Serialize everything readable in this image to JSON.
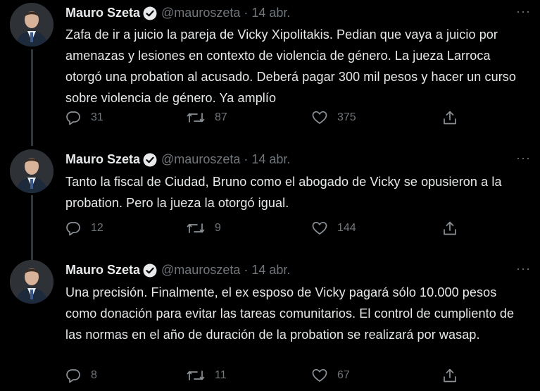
{
  "tweets": [
    {
      "author": "Mauro Szeta",
      "handle": "@mauroszeta",
      "separator": "·",
      "date": "14 abr.",
      "text": "Zafa de ir a juicio la pareja de Vicky Xipolitakis. Pedian que vaya a juicio por amenazas y lesiones en contexto de violencia de género. La jueza Larroca otorgó una probation al acusado. Deberá pagar 300 mil pesos y hacer un curso sobre violencia de género. Ya amplío",
      "replies": "31",
      "retweets": "87",
      "likes": "375"
    },
    {
      "author": "Mauro Szeta",
      "handle": "@mauroszeta",
      "separator": "·",
      "date": "14 abr.",
      "text": "Tanto la fiscal de Ciudad, Bruno como el abogado de Vicky se opusieron a la probation. Pero la jueza la otorgó igual.",
      "replies": "12",
      "retweets": "9",
      "likes": "144"
    },
    {
      "author": "Mauro Szeta",
      "handle": "@mauroszeta",
      "separator": "·",
      "date": "14 abr.",
      "text": "Una precisión. Finalmente, el ex esposo de Vicky pagará sólo 10.000 pesos como donación para evitar las tareas comunitarios. El control de cumpliento de las normas en el año de duración de la probation se realizará por wasap.",
      "replies": "8",
      "retweets": "11",
      "likes": "67"
    }
  ],
  "icons": {
    "verified": "verified-badge-icon",
    "more": "more-icon",
    "reply": "reply-icon",
    "retweet": "retweet-icon",
    "like": "like-icon",
    "share": "share-icon"
  },
  "more_glyph": "···"
}
